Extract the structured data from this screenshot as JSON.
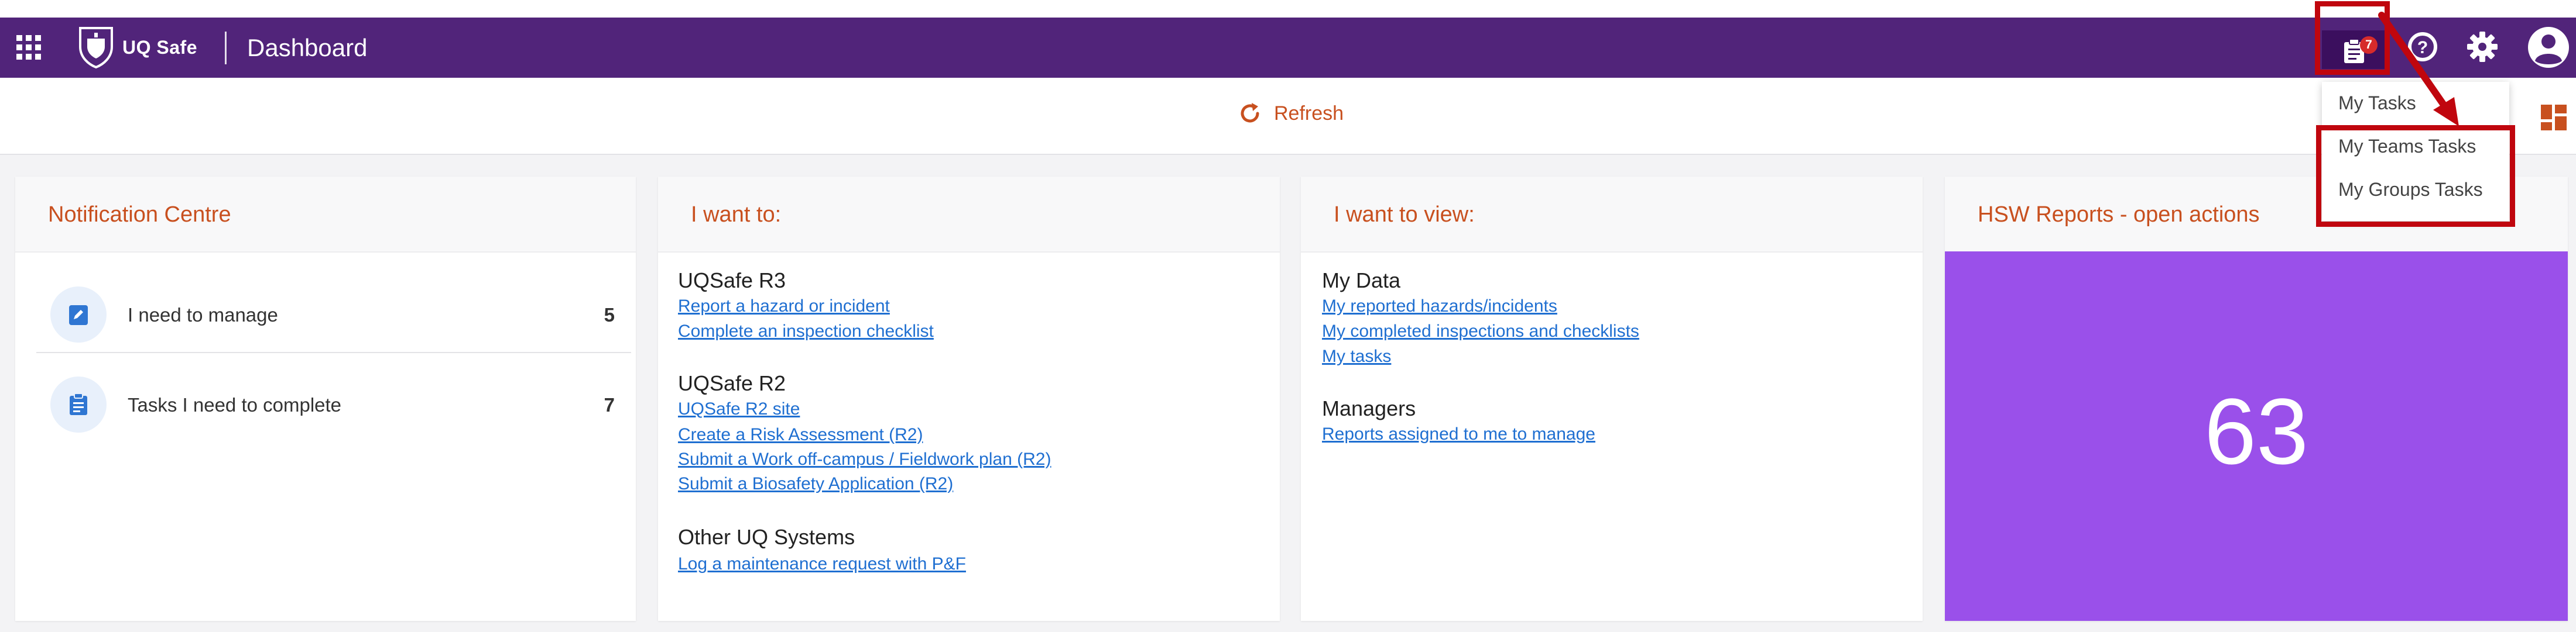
{
  "header": {
    "logo_text": "UQ Safe",
    "title": "Dashboard",
    "tasks_badge_count": "7",
    "icons": [
      "apps-grid-icon",
      "uq-shield-logo",
      "tasks-clipboard-icon",
      "help-icon",
      "gear-icon",
      "account-icon"
    ],
    "bar_color": "#51247a"
  },
  "toolbar": {
    "refresh_label": "Refresh"
  },
  "tasks_menu": {
    "items": [
      "My Tasks",
      "My Teams Tasks",
      "My Groups Tasks"
    ]
  },
  "notification_centre": {
    "title": "Notification Centre",
    "rows": [
      {
        "label": "I need to manage",
        "count": "5",
        "icon": "edit-icon"
      },
      {
        "label": "Tasks I need to complete",
        "count": "7",
        "icon": "clipboard-icon"
      }
    ]
  },
  "i_want_to": {
    "title": "I want to:",
    "groups": [
      {
        "heading": "UQSafe R3",
        "links": [
          "Report a hazard or incident",
          "Complete an inspection checklist"
        ]
      },
      {
        "heading": "UQSafe R2",
        "links": [
          "UQSafe R2 site",
          "Create a Risk Assessment (R2)",
          "Submit a Work off-campus / Fieldwork plan (R2)",
          "Submit a Biosafety Application (R2)"
        ]
      },
      {
        "heading": "Other UQ Systems",
        "links": [
          "Log a maintenance request with P&F"
        ]
      }
    ]
  },
  "i_want_to_view": {
    "title": "I want to view:",
    "groups": [
      {
        "heading": "My Data",
        "links": [
          "My reported hazards/incidents",
          "My completed inspections and checklists",
          "My tasks"
        ]
      },
      {
        "heading": "Managers",
        "links": [
          "Reports assigned to me to manage"
        ]
      }
    ]
  },
  "hsw_reports": {
    "title": "HSW Reports - open actions",
    "value": "63",
    "tile_color": "#9a50ea"
  },
  "colors": {
    "accent": "#c8501f",
    "link": "#1f6fd1",
    "annotation": "#c0060e"
  }
}
